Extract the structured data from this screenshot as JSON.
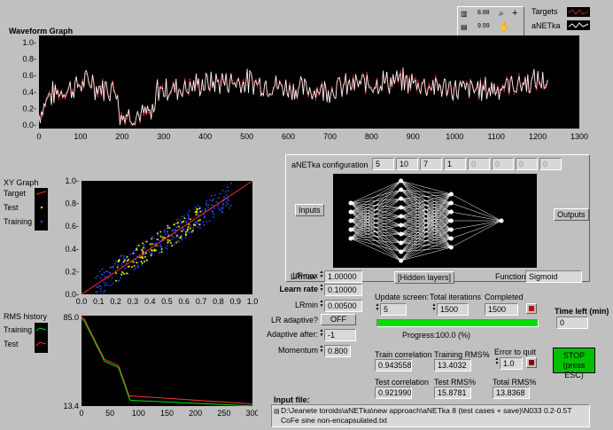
{
  "waveform": {
    "title": "Waveform Graph",
    "y_ticks": [
      "1.0-",
      "0.8-",
      "0.6-",
      "0.4-",
      "0.2-",
      "0.0-"
    ],
    "x_ticks": [
      "0",
      "100",
      "200",
      "300",
      "400",
      "500",
      "600",
      "700",
      "800",
      "900",
      "1000",
      "1100",
      "1200",
      "1300"
    ],
    "legend": {
      "targets": "Targets",
      "anetka": "aNETka"
    }
  },
  "xy": {
    "title": "XY Graph",
    "legend": [
      "Target",
      "Test",
      "Training"
    ],
    "y_ticks": [
      "1.0-",
      "0.8-",
      "0.6-",
      "0.4-",
      "0.2-",
      "0.0-"
    ],
    "x_ticks": [
      "0.0",
      "0.1",
      "0.2",
      "0.3",
      "0.4",
      "0.5",
      "0.6",
      "0.7",
      "0.8",
      "0.9",
      "1.0"
    ]
  },
  "rms": {
    "title": "RMS history",
    "legend": [
      "Training",
      "Test"
    ],
    "y_top": "85.0",
    "y_bottom": "13.4",
    "x_ticks": [
      "0",
      "50",
      "100",
      "150",
      "200",
      "250",
      "300"
    ]
  },
  "config": {
    "label": "aNETka configuration",
    "layers": [
      "5",
      "10",
      "7",
      "1",
      "0",
      "0",
      "0",
      "0"
    ],
    "inputs_button": "Inputs",
    "outputs_button": "Outputs",
    "hidden_button": "[Hidden layers]",
    "function_label": "Function",
    "function_value": "Sigmoid"
  },
  "params": {
    "lrmax_label": "LRmax",
    "lrmax": "1.00000",
    "learn_rate_label": "Learn rate",
    "learn_rate": "0.10000",
    "lrmin_label": "LRmin",
    "lrmin": "0.00500",
    "lr_adaptive_label": "LR adaptive?",
    "lr_adaptive": "OFF",
    "adaptive_after_label": "Adaptive after:",
    "adaptive_after": "-1",
    "momentum_label": "Momentum",
    "momentum": "0.800"
  },
  "status": {
    "update_label": "Update screen:",
    "update": "5",
    "total_iter_label": "Total iterations",
    "total_iter": "1500",
    "completed_label": "Completed",
    "completed": "1500",
    "progress_label": "Progress:",
    "progress_value": "100.0",
    "progress_unit": "(%)",
    "progress_fraction": 1.0,
    "time_left_label": "Time left (min)",
    "time_left": "0",
    "train_corr_label": "Train correlation",
    "train_corr": "0.943558",
    "training_rms_label": "Training RMS%",
    "training_rms": "13.4032",
    "error_quit_label": "Error to quit",
    "error_quit": "1.0",
    "test_corr_label": "Test correlation",
    "test_corr": "0.921990",
    "test_rms_label": "Test RMS%",
    "test_rms": "15.8781",
    "total_rms_label": "Total RMS%",
    "total_rms": "13.8368",
    "stop_line1": "STOP",
    "stop_line2": "(press ESC)"
  },
  "input_file": {
    "label": "Input file:",
    "line1": "D:\\Jeanete toroids\\aNETka\\new approach\\aNETka 8 (test cases + save)\\N033 0.2-0.5T",
    "line2": "CoFe sine non-encapsulated.txt"
  },
  "colors": {
    "target": "#ff3030",
    "test": "#e8e800",
    "training": "#2050ff",
    "stop": "#00c000",
    "led": "#d00000",
    "progress": "#00e000"
  }
}
